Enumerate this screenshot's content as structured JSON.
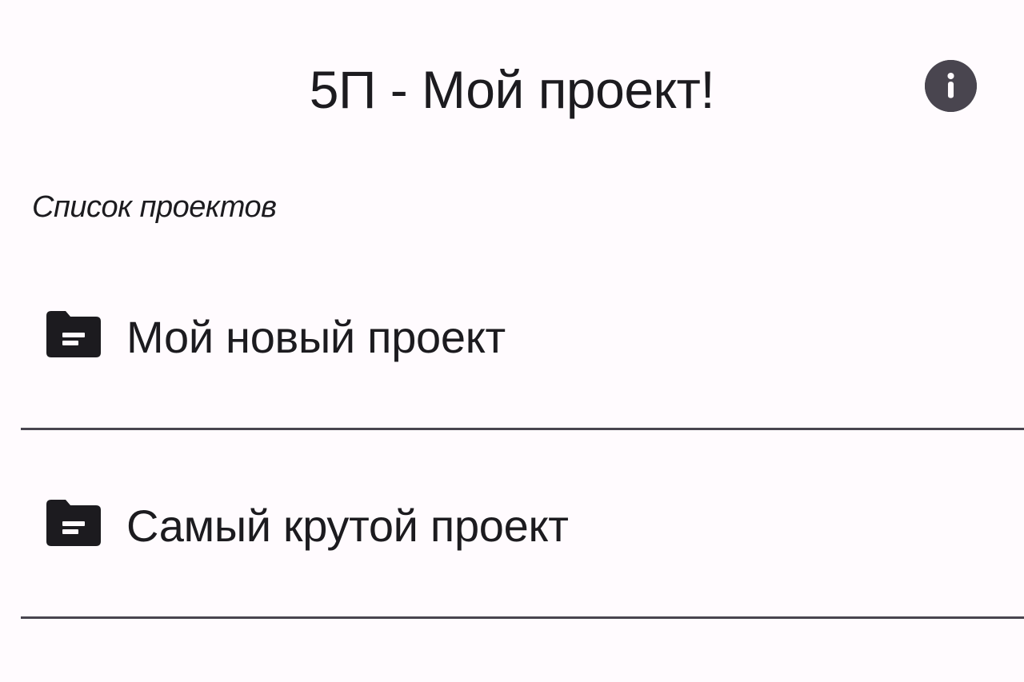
{
  "app_bar": {
    "title": "5П - Мой проект!",
    "info_icon": "info-icon"
  },
  "section_label": "Список проектов",
  "projects": [
    {
      "name": "Мой новый проект",
      "icon": "folder-icon"
    },
    {
      "name": "Самый крутой проект",
      "icon": "folder-icon"
    }
  ],
  "colors": {
    "background": "#fffbfe",
    "text": "#1c1b1f",
    "icon": "#1c1b1f",
    "info_button": "#49454f",
    "divider": "#49454f"
  }
}
